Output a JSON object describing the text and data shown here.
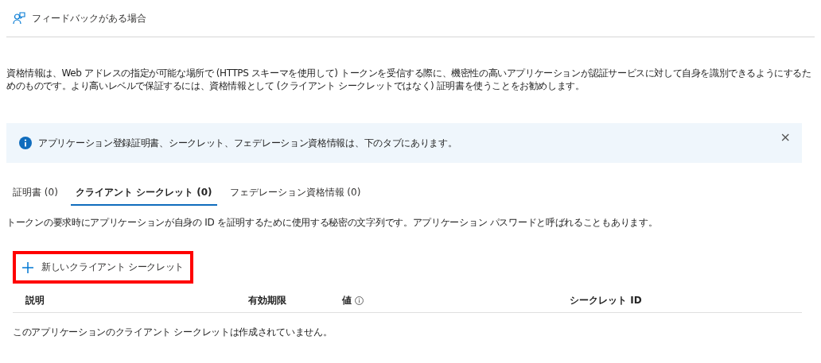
{
  "header": {
    "feedback_link": "フィードバックがある場合"
  },
  "description": "資格情報は、Web アドレスの指定が可能な場所で (HTTPS スキーマを使用して) トークンを受信する際に、機密性の高いアプリケーションが認証サービスに対して自身を識別できるようにするためのものです。より高いレベルで保証するには、資格情報として (クライアント シークレットではなく) 証明書を使うことをお勧めします。",
  "info_banner": {
    "message": "アプリケーション登録証明書、シークレット、フェデレーション資格情報は、下のタブにあります。",
    "close": "×"
  },
  "tabs": [
    {
      "label": "証明書 (0)",
      "selected": false
    },
    {
      "label": "クライアント シークレット (0)",
      "selected": true
    },
    {
      "label": "フェデレーション資格情報 (0)",
      "selected": false
    }
  ],
  "tab_description": "トークンの要求時にアプリケーションが自身の ID を証明するために使用する秘密の文字列です。アプリケーション パスワードと呼ばれることもあります。",
  "new_button": {
    "label": "新しいクライアント シークレット",
    "highlighted": true
  },
  "table": {
    "columns": [
      {
        "label": "説明",
        "info": false
      },
      {
        "label": "有効期限",
        "info": false
      },
      {
        "label": "値",
        "info": true
      },
      {
        "label": "シークレット ID",
        "info": false
      }
    ],
    "empty_message": "このアプリケーションのクライアント シークレットは作成されていません。"
  }
}
